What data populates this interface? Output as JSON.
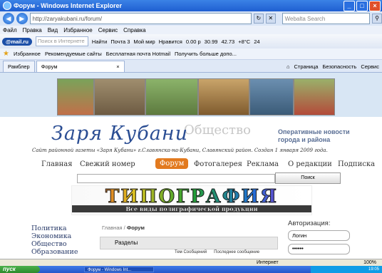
{
  "window": {
    "title": "Форум - Windows Internet Explorer"
  },
  "browser": {
    "address": "http://zaryakubani.ru/forum/",
    "web_search_placeholder": "Webalta Search",
    "menu": [
      "Файл",
      "Правка",
      "Вид",
      "Избранное",
      "Сервис",
      "Справка"
    ],
    "mail_toolbar": {
      "badge": "@mail.ru",
      "search_placeholder": "Поиск в Интернете",
      "find": "Найти",
      "items": [
        "Почта 3",
        "Мой мир",
        "Нравится",
        "0.00 р",
        "30.99",
        "42.73",
        "+8°C",
        "24"
      ]
    },
    "favorites": {
      "label": "Избранное",
      "items": [
        "Рекомендуемые сайты",
        "Бесплатная почта Hotmail",
        "Получить больше допо..."
      ]
    },
    "tabs": [
      {
        "label": "Рамблер"
      },
      {
        "label": "Форум"
      }
    ],
    "commands": [
      "Страница",
      "Безопасность",
      "Сервис"
    ],
    "status": {
      "zone": "Интернет",
      "zoom": "100%"
    }
  },
  "site": {
    "title": "Заря Кубани",
    "watermark": "Общество",
    "online_news": "Оперативные новости города и района",
    "subtitle": "Сайт районной газеты «Заря Кубани» г.Славянска-на-Кубани, Славянский район. Создан 1 января 2009 года.",
    "nav": [
      "Главная",
      "Свежий номер",
      "Форум",
      "Фотогалерея",
      "Реклама",
      "О редакции",
      "Подписка"
    ],
    "search_button": "Поиск",
    "banner": {
      "title": "ТИПОГРАФИЯ",
      "subtitle": "Все виды полиграфической продукции"
    },
    "left_nav": [
      "Политика",
      "Экономика",
      "Общество",
      "Образование"
    ],
    "breadcrumb": {
      "home": "Главная",
      "sep": "/",
      "current": "Форум"
    },
    "forum": {
      "header": "Разделы",
      "col1": "Тем Сообщений",
      "col2": "Последнее сообщение"
    },
    "auth": {
      "title": "Авторизация:",
      "login": "Логин",
      "password": "••••••"
    }
  },
  "taskbar": {
    "start": "пуск",
    "item": "Форум - Windows Int...",
    "tray": "19:05"
  }
}
